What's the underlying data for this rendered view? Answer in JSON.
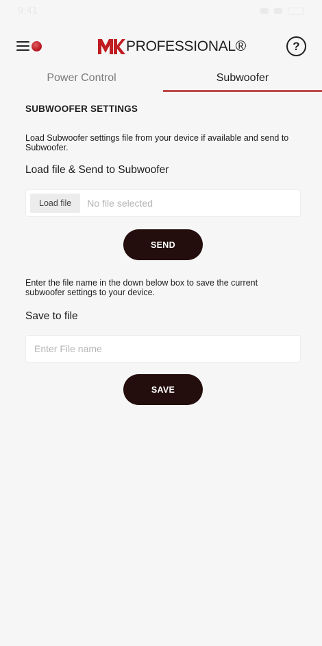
{
  "status_bar": {
    "time": "9:41"
  },
  "header": {
    "menu_icon": "hamburger-menu-icon",
    "status_indicator_color": "#b5121b",
    "logo_brand": "MK",
    "logo_text": "PROFESSIONAL®",
    "help_label": "?"
  },
  "tabs": [
    {
      "label": "Power Control",
      "active": false
    },
    {
      "label": "Subwoofer",
      "active": true
    }
  ],
  "accent_color": "#c0494a",
  "button_color": "#240d0d",
  "settings": {
    "title": "SUBWOOFER SETTINGS",
    "load_description": "Load Subwoofer settings file from your device if available and send to Subwoofer.",
    "load_label": "Load file & Send to Subwoofer",
    "file_button_label": "Load file",
    "file_status": "No file selected",
    "send_label": "SEND",
    "save_description": "Enter the file name in the down below box to save the current subwoofer settings to your device.",
    "save_label_heading": "Save to file",
    "filename_value": "",
    "filename_placeholder": "Enter File name",
    "save_button_label": "SAVE"
  }
}
